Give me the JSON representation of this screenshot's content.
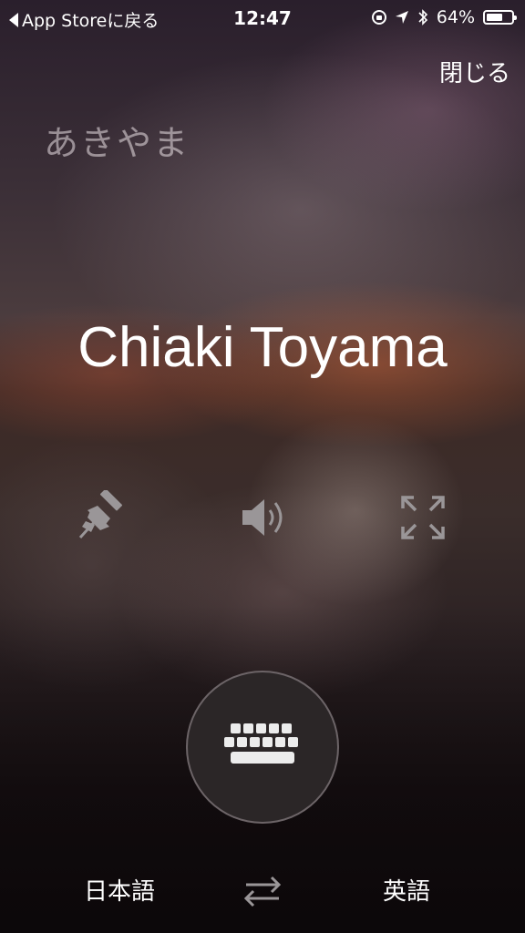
{
  "status_bar": {
    "back_label": "App Storeに戻る",
    "time": "12:47",
    "battery_percent": "64%",
    "battery_level": 0.64
  },
  "header": {
    "close_label": "閉じる"
  },
  "translation": {
    "source_text": "あきやま",
    "result_text": "Chiaki Toyama"
  },
  "actions": {
    "pin_icon": "pin-icon",
    "speaker_icon": "speaker-icon",
    "fullscreen_icon": "fullscreen-icon"
  },
  "keyboard_icon": "keyboard-icon",
  "languages": {
    "source": "日本語",
    "target": "英語",
    "swap_icon": "swap-arrows-icon"
  },
  "colors": {
    "icon_gray": "#9a9698",
    "text_white": "#ffffff"
  }
}
